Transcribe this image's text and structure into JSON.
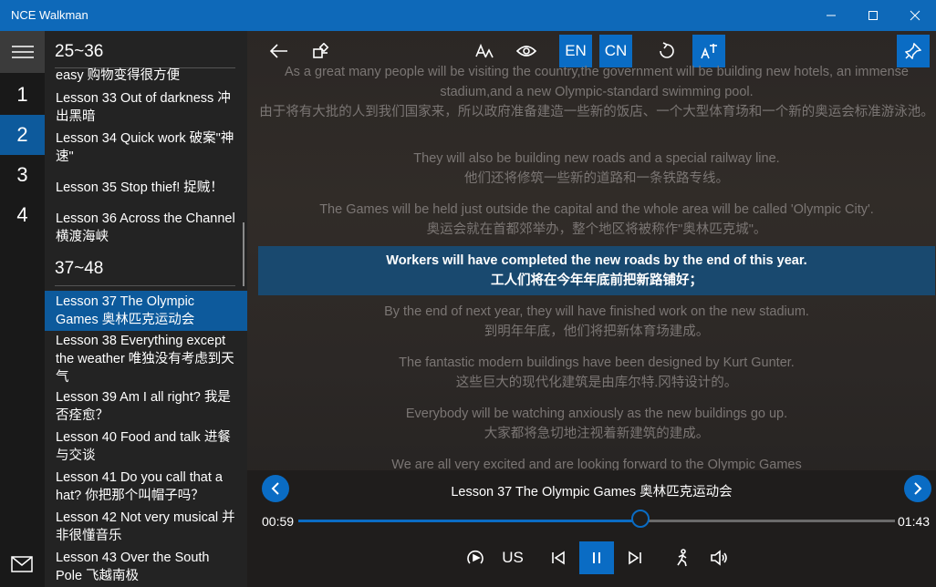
{
  "window": {
    "title": "NCE Walkman"
  },
  "rail": {
    "numbers": [
      "1",
      "2",
      "3",
      "4"
    ],
    "selected": "2"
  },
  "list": {
    "group1": "25~36",
    "group2": "37~48",
    "partial_top": "easy 购物变得很方便",
    "items": [
      "Lesson 33  Out of darkness 冲出黑暗",
      "Lesson 34  Quick work 破案\"神速\"",
      "Lesson 35  Stop thief! 捉贼！",
      "Lesson 36  Across the Channel 横渡海峡",
      "Lesson 37  The Olympic Games 奥林匹克运动会",
      "Lesson 38  Everything except the weather 唯独没有考虑到天气",
      "Lesson 39  Am I all right? 我是否痊愈？",
      "Lesson 40  Food and talk 进餐与交谈",
      "Lesson 41  Do you call that a hat? 你把那个叫帽子吗？",
      "Lesson 42  Not very musical 并非很懂音乐",
      "Lesson 43  Over the South Pole 飞越南极"
    ],
    "selected_index": 4
  },
  "toolbar": {
    "en": "EN",
    "cn": "CN"
  },
  "lyrics": [
    {
      "en": "As a great many people will be visiting the country,the government will be building new hotels, an immense stadium,and a new Olympic-standard swimming pool.",
      "cn": "由于将有大批的人到我们国家来，所以政府准备建造一些新的饭店、一个大型体育场和一个新的奥运会标准游泳池。"
    },
    {
      "en": "They will also be building new roads and a special railway line.",
      "cn": "他们还将修筑一些新的道路和一条铁路专线。"
    },
    {
      "en": "The Games will be held just outside the capital and the whole area will be called 'Olympic City'.",
      "cn": "奥运会就在首都郊举办，整个地区将被称作\"奥林匹克城\"。"
    },
    {
      "en": "Workers will have completed the new roads by the end of this year.",
      "cn": "工人们将在今年年底前把新路铺好；"
    },
    {
      "en": "By the end of next year, they will have finished work on the new stadium.",
      "cn": "到明年年底，他们将把新体育场建成。"
    },
    {
      "en": "The fantastic modern buildings have been designed by Kurt Gunter.",
      "cn": "这些巨大的现代化建筑是由库尔特.冈特设计的。"
    },
    {
      "en": "Everybody will be watching anxiously as the new buildings go up.",
      "cn": "大家都将急切地注视着新建筑的建成。"
    },
    {
      "en": "We are all very excited and are looking forward to the Olympic Games",
      "cn": ""
    }
  ],
  "player": {
    "now_playing": "Lesson 37  The Olympic Games 奥林匹克运动会",
    "elapsed": "00:59",
    "total": "01:43",
    "progress": 0.573,
    "accent": "US"
  },
  "colors": {
    "accent": "#0a6cc4",
    "titlebar": "#0e69b9",
    "selected": "#0d5a9c"
  }
}
